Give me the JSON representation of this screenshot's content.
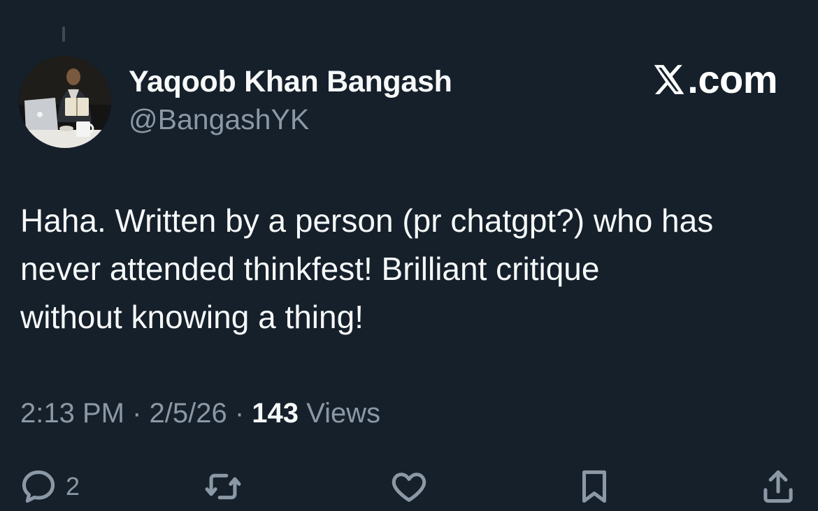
{
  "author": {
    "name": "Yaqoob Khan Bangash",
    "handle": "@BangashYK"
  },
  "brand": {
    "label": ".com",
    "icon": "x-logo-icon"
  },
  "tweet": {
    "text": "Haha. Written by a person (pr chatgpt?) who has\nnever attended thinkfest! Brilliant critique\nwithout knowing a thing!"
  },
  "meta": {
    "time": "2:13 PM",
    "date": "2/5/26",
    "separator": " · ",
    "views_count": "143",
    "views_label": " Views"
  },
  "actions": {
    "reply": {
      "icon": "reply-icon",
      "count": "2"
    },
    "retweet": {
      "icon": "retweet-icon"
    },
    "like": {
      "icon": "heart-icon"
    },
    "bookmark": {
      "icon": "bookmark-icon"
    },
    "share": {
      "icon": "share-icon"
    }
  },
  "colors": {
    "background": "#15202b",
    "primary_text": "#f7f9f9",
    "secondary_text": "#8b98a5"
  }
}
